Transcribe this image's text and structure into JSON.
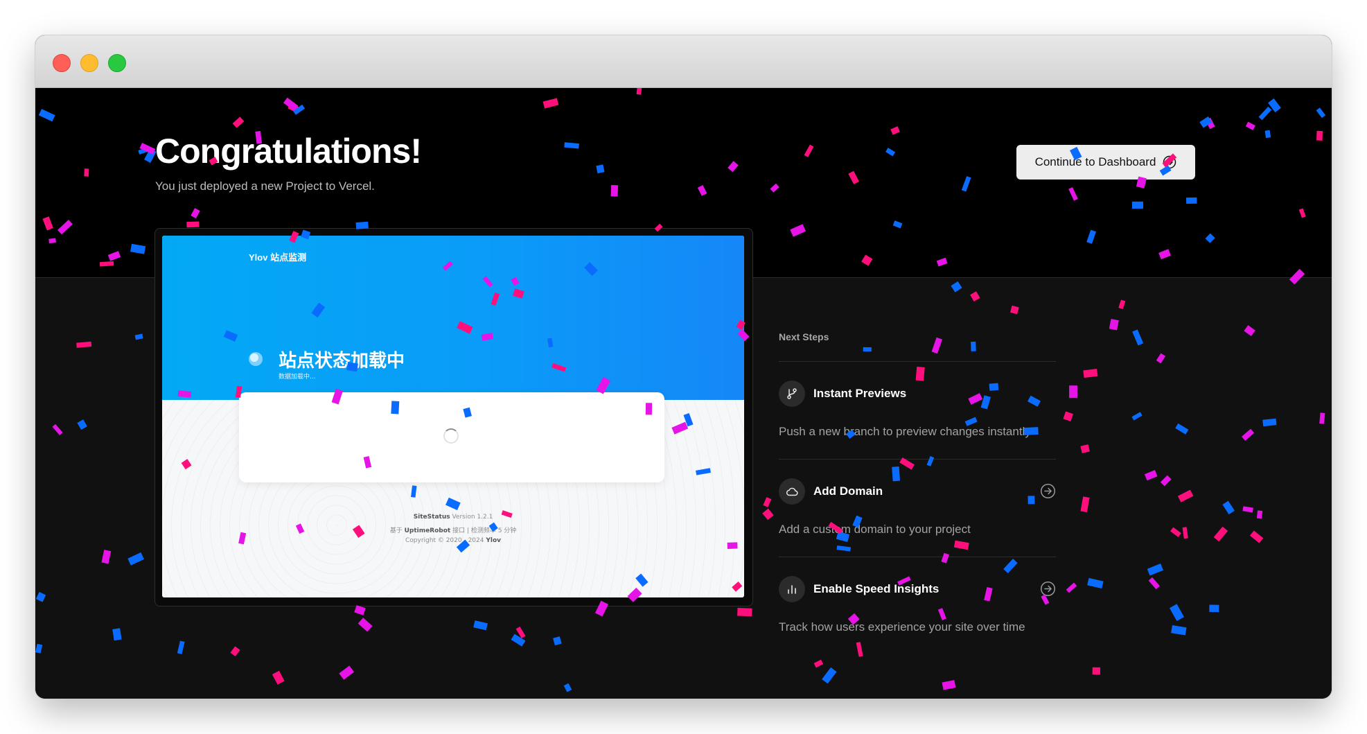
{
  "header": {
    "title": "Congratulations!",
    "subtitle": "You just deployed a new Project to Vercel.",
    "dashboard_button": "Continue to Dashboard"
  },
  "preview": {
    "brand": "Ylov 站点监测",
    "loading_title": "站点状态加载中",
    "loading_subtitle": "数据加载中...",
    "footer_site_name": "SiteStatus",
    "footer_version": " Version 1.2.1",
    "footer_line2_prefix": "基于 ",
    "footer_line2_brand": "UptimeRobot",
    "footer_line2_suffix": " 接口 | 检测频率 5 分钟",
    "footer_line3_prefix": "Copyright © 2020 - 2024 ",
    "footer_line3_brand": "Ylov"
  },
  "next_steps": {
    "heading": "Next Steps",
    "items": [
      {
        "title": "Instant Previews",
        "description": "Push a new branch to preview changes instantly",
        "icon": "git-branch-icon"
      },
      {
        "title": "Add Domain",
        "description": "Add a custom domain to your project",
        "icon": "cloud-icon"
      },
      {
        "title": "Enable Speed Insights",
        "description": "Track how users experience your site over time",
        "icon": "bar-chart-icon"
      }
    ]
  },
  "colors": {
    "confetti_pink": "#ff0f7b",
    "confetti_magenta": "#e614e6",
    "confetti_blue": "#0a6cff",
    "preview_header_blue": "#03a9f5"
  }
}
